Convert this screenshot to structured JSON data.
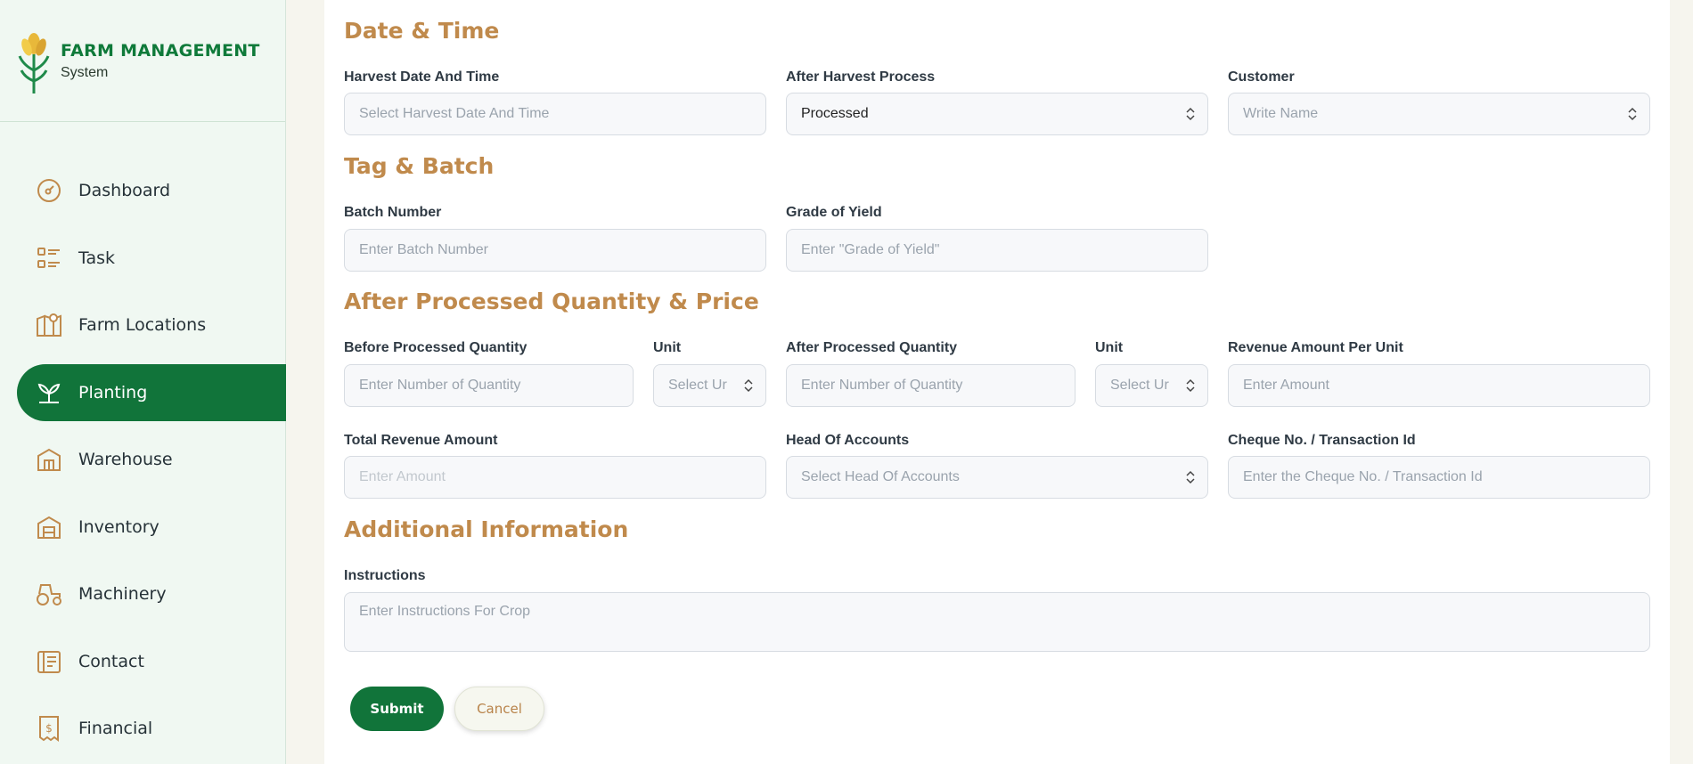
{
  "app": {
    "title": "FARM MANAGEMENT",
    "subtitle": "System"
  },
  "nav": [
    {
      "label": "Dashboard",
      "icon": "dashboard-icon"
    },
    {
      "label": "Task",
      "icon": "task-list-icon"
    },
    {
      "label": "Farm Locations",
      "icon": "map-pin-icon"
    },
    {
      "label": "Planting",
      "icon": "sprout-icon",
      "active": true
    },
    {
      "label": "Warehouse",
      "icon": "warehouse-icon"
    },
    {
      "label": "Inventory",
      "icon": "inventory-icon"
    },
    {
      "label": "Machinery",
      "icon": "tractor-icon"
    },
    {
      "label": "Contact",
      "icon": "contact-icon"
    },
    {
      "label": "Financial",
      "icon": "financial-icon"
    }
  ],
  "sections": {
    "date_time": "Date & Time",
    "tag_batch": "Tag & Batch",
    "quantity_price": "After Processed Quantity & Price",
    "additional": "Additional Information"
  },
  "fields": {
    "harvest_date": {
      "label": "Harvest Date And Time",
      "placeholder": "Select Harvest Date And Time"
    },
    "after_harvest_process": {
      "label": "After Harvest Process",
      "value": "Processed"
    },
    "customer": {
      "label": "Customer",
      "placeholder": "Write Name"
    },
    "batch_number": {
      "label": "Batch Number",
      "placeholder": "Enter Batch Number"
    },
    "grade_of_yield": {
      "label": "Grade of Yield",
      "placeholder": "Enter \"Grade of Yield\""
    },
    "before_qty": {
      "label": "Before Processed Quantity",
      "placeholder": "Enter Number of Quantity"
    },
    "unit1": {
      "label": "Unit",
      "placeholder": "Select Ur"
    },
    "after_qty": {
      "label": "After Processed Quantity",
      "placeholder": "Enter Number of Quantity"
    },
    "unit2": {
      "label": "Unit",
      "placeholder": "Select Ur"
    },
    "revenue_per_unit": {
      "label": "Revenue Amount Per Unit",
      "placeholder": "Enter Amount"
    },
    "total_revenue": {
      "label": "Total Revenue Amount",
      "placeholder": "Enter Amount"
    },
    "head_of_accounts": {
      "label": "Head Of Accounts",
      "placeholder": "Select Head Of Accounts"
    },
    "cheque": {
      "label": "Cheque No. / Transaction Id",
      "placeholder": "Enter the Cheque No. / Transaction Id"
    },
    "instructions": {
      "label": "Instructions",
      "placeholder": "Enter Instructions For Crop"
    }
  },
  "buttons": {
    "submit": "Submit",
    "cancel": "Cancel"
  },
  "colors": {
    "brand_green": "#11743a",
    "accent_gold": "#c08a4c"
  }
}
